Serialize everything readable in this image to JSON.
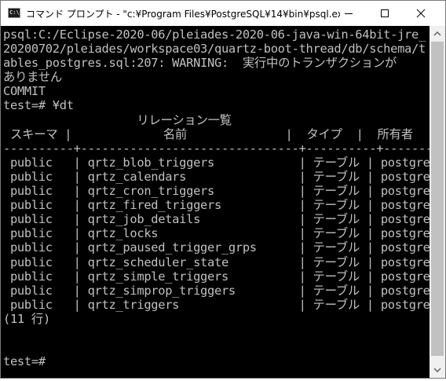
{
  "window": {
    "title": "コマンド プロンプト - \"c:¥Program Files¥PostgreSQL¥14¥bin¥psql.exe\"  -h loc...",
    "icon_text": "C:\\."
  },
  "controls": [
    "minimize-icon",
    "maximize-icon",
    "close-icon"
  ],
  "console": {
    "lines": [
      "psql:C:/Eclipse-2020-06/pleiades-2020-06-java-win-64bit-jre_",
      "20200702/pleiades/workspace03/quartz-boot-thread/db/schema/t",
      "ables_postgres.sql:207: WARNING:  実行中のトランザクションが",
      "ありません",
      "COMMIT",
      "test=# ¥dt",
      "                   リレーション一覧",
      " スキーマ |             名前              |  タイプ  |  所有者",
      "----------+-------------------------------+----------+----------",
      " public   | qrtz_blob_triggers            | テーブル | postgres",
      " public   | qrtz_calendars                | テーブル | postgres",
      " public   | qrtz_cron_triggers            | テーブル | postgres",
      " public   | qrtz_fired_triggers           | テーブル | postgres",
      " public   | qrtz_job_details              | テーブル | postgres",
      " public   | qrtz_locks                    | テーブル | postgres",
      " public   | qrtz_paused_trigger_grps      | テーブル | postgres",
      " public   | qrtz_scheduler_state          | テーブル | postgres",
      " public   | qrtz_simple_triggers          | テーブル | postgres",
      " public   | qrtz_simprop_triggers         | テーブル | postgres",
      " public   | qrtz_triggers                 | テーブル | postgres",
      "(11 行)",
      "",
      "",
      "test=#"
    ]
  }
}
